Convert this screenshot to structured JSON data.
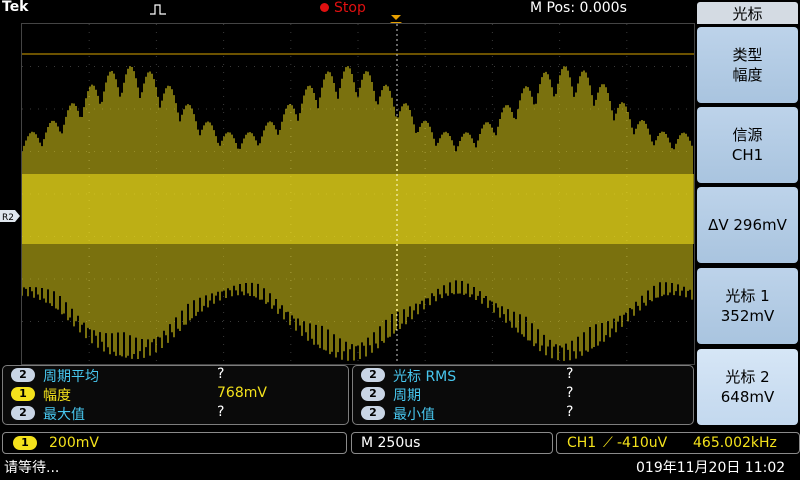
{
  "header": {
    "brand": "Tek",
    "run_state": "Stop",
    "horizontal_position": "M Pos: 0.000s"
  },
  "markers": {
    "ref_label": "R2",
    "trigger_label": "T"
  },
  "side_menu": {
    "title": "光标",
    "buttons": [
      {
        "line1": "类型",
        "line2": "幅度"
      },
      {
        "line1": "信源",
        "line2": "CH1"
      },
      {
        "line1": "ΔV 296mV",
        "line2": ""
      },
      {
        "line1": "光标 1",
        "line2": "352mV"
      },
      {
        "line1": "光标 2",
        "line2": "648mV"
      }
    ]
  },
  "measurements": {
    "left": [
      {
        "ch": "2",
        "label": "周期平均",
        "value": "?"
      },
      {
        "ch": "1",
        "label": "幅度",
        "value": "768mV"
      },
      {
        "ch": "2",
        "label": "最大值",
        "value": "?"
      }
    ],
    "right": [
      {
        "ch": "2",
        "label": "光标 RMS",
        "value": "?"
      },
      {
        "ch": "2",
        "label": "周期",
        "value": "?"
      },
      {
        "ch": "2",
        "label": "最小值",
        "value": "?"
      }
    ]
  },
  "status": {
    "ch1_badge": "1",
    "ch1_scale": "200mV",
    "timebase": "M 250us",
    "trigger_source": "CH1",
    "trigger_slope": "⟋",
    "trigger_level": "-410uV",
    "trigger_freq": "465.002kHz",
    "message": "请等待...",
    "datetime": "019年11月20日 11:02"
  },
  "colors": {
    "ch1": "#f4e21c",
    "cursor_line": "#d9a400",
    "menu_bg": "#b4cce6",
    "label_blue": "#48c7ef",
    "stop_red": "#e01010"
  }
}
